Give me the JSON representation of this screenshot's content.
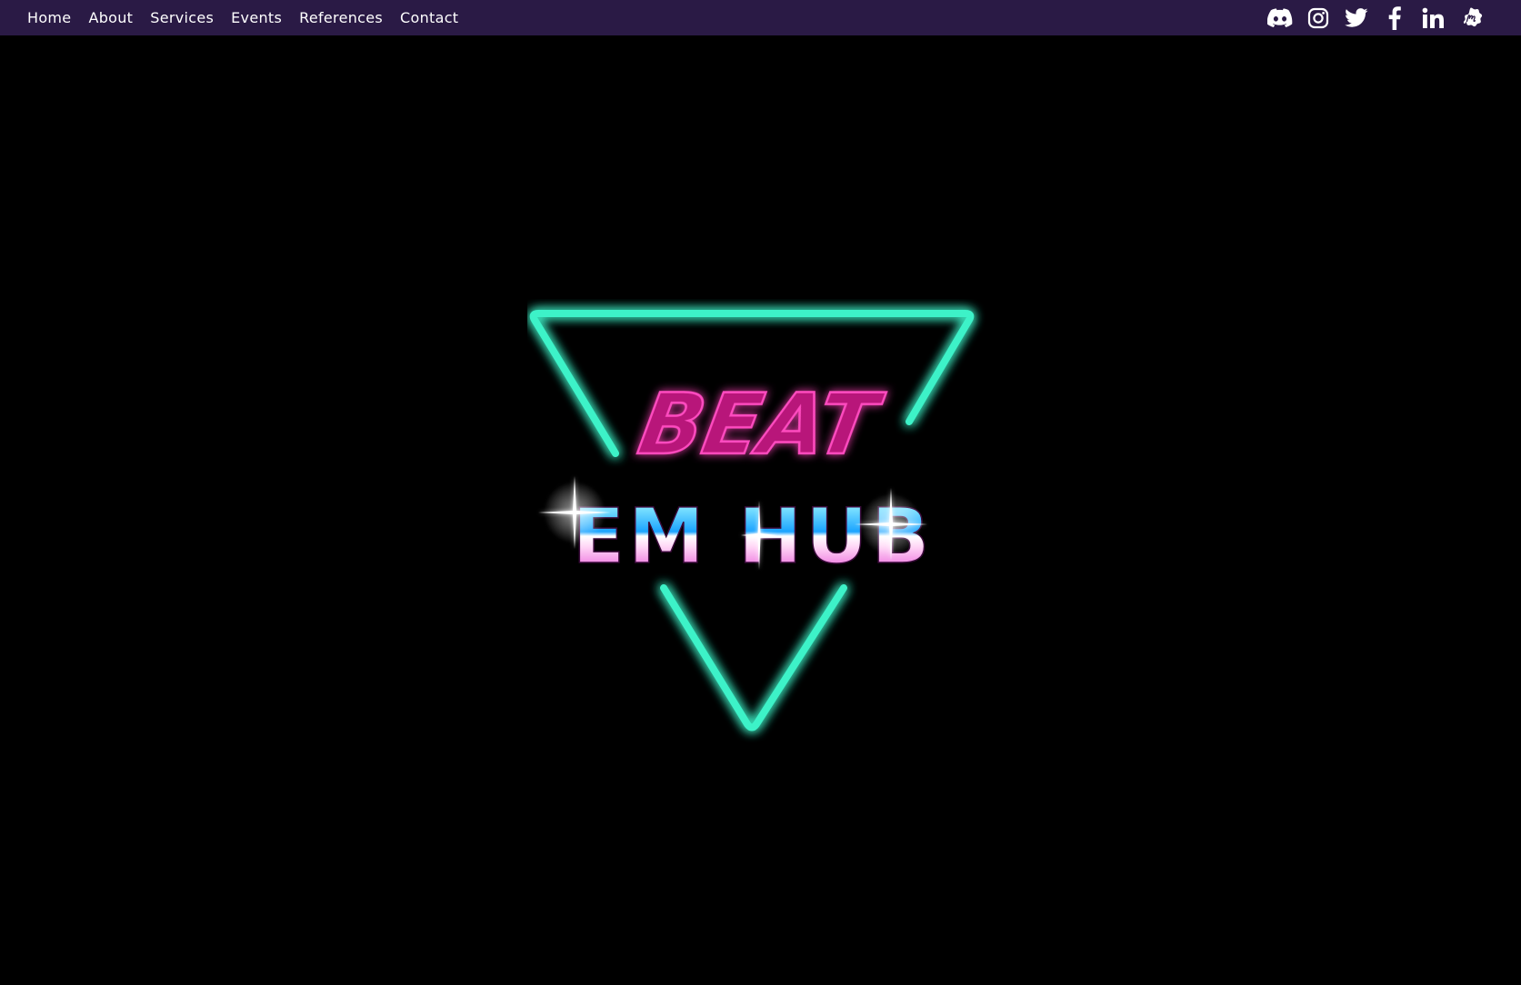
{
  "nav": {
    "links": [
      "Home",
      "About",
      "Services",
      "Events",
      "References",
      "Contact"
    ]
  },
  "socials": [
    "discord-icon",
    "instagram-icon",
    "twitter-icon",
    "facebook-icon",
    "linkedin-icon",
    "meetup-icon"
  ],
  "logo": {
    "word_top": "BEAT",
    "word_bottom": "EM HUB"
  },
  "colors": {
    "navbar": "#2a1a45",
    "background": "#000000",
    "neon_teal": "#3cf2c8",
    "neon_pink": "#e0279b"
  }
}
